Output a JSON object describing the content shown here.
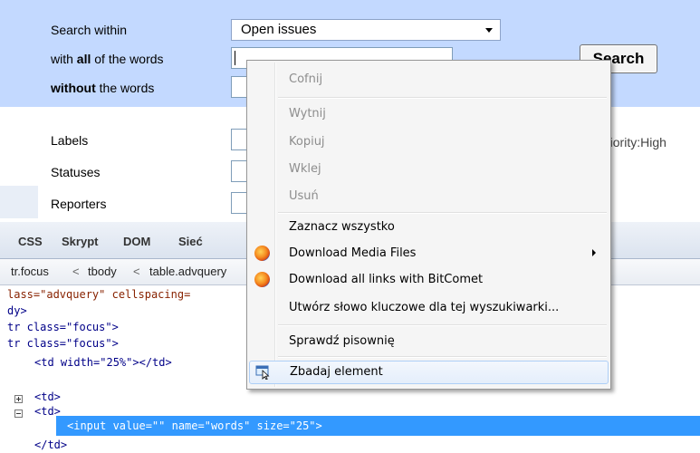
{
  "search_form": {
    "row1_label": "Search within",
    "scope_value": "Open issues",
    "row2_prefix": "with ",
    "row2_bold": "all",
    "row2_suffix": " of the words",
    "row3_bold": "without",
    "row3_suffix": " the words",
    "search_button": "Search",
    "labels_label": "Labels",
    "statuses_label": "Statuses",
    "reporters_label": "Reporters",
    "hint_text": "riority:High"
  },
  "firebug": {
    "tabs": [
      "CSS",
      "Skrypt",
      "DOM",
      "Sieć"
    ],
    "breadcrumbs": [
      "tr.focus",
      "tbody",
      "table.advquery"
    ],
    "crumb_separator": "<",
    "code_lines": [
      {
        "id": "l1",
        "html": "lass=\"advquery\" cellspacing="
      },
      {
        "id": "l2",
        "text": "dy>"
      },
      {
        "id": "l3",
        "text": "tr class=\"focus\">"
      },
      {
        "id": "l4",
        "text": "tr class=\"focus\">"
      },
      {
        "id": "l5",
        "text": "<td width=\"25%\"></td>"
      },
      {
        "id": "l6",
        "text": "<td>"
      },
      {
        "id": "l7",
        "text": "<td>"
      },
      {
        "id": "l8",
        "text": "<input value=\"\" name=\"words\" size=\"25\">"
      },
      {
        "id": "l9",
        "text": "</td>"
      }
    ]
  },
  "context_menu": {
    "items": [
      {
        "label": "Cofnij",
        "disabled": true
      },
      {
        "label": "Wytnij",
        "disabled": true
      },
      {
        "label": "Kopiuj",
        "disabled": true
      },
      {
        "label": "Wklej",
        "disabled": true
      },
      {
        "label": "Usuń",
        "disabled": true
      },
      {
        "label": "Zaznacz wszystko",
        "disabled": false
      },
      {
        "label": "Download Media Files",
        "disabled": false,
        "icon": "firefox-addon-icon",
        "submenu": true
      },
      {
        "label": "Download all links with BitComet",
        "disabled": false,
        "icon": "firefox-addon-icon"
      },
      {
        "label": "Utwórz słowo kluczowe dla tej wyszukiwarki...",
        "disabled": false
      },
      {
        "label": "Sprawdź pisownię",
        "disabled": false
      },
      {
        "label": "Zbadaj element",
        "disabled": false,
        "icon": "inspect-element-icon",
        "highlighted": true
      }
    ]
  },
  "colors": {
    "search_band": "#c3d9ff",
    "selection": "#3399ff",
    "menu_background": "#f5f5f5"
  }
}
